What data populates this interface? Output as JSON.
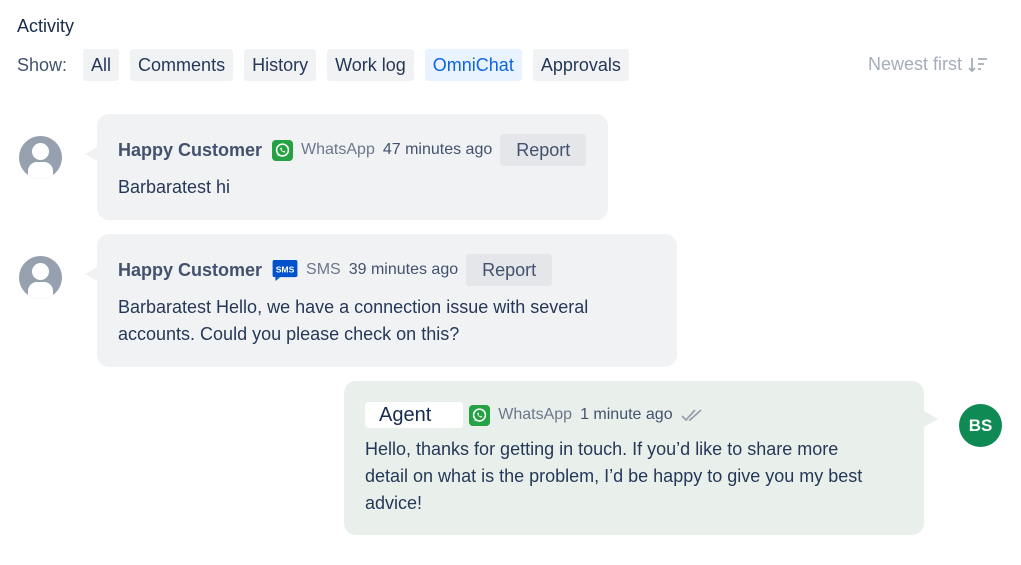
{
  "header": {
    "title": "Activity"
  },
  "filters": {
    "show_label": "Show:",
    "items": [
      "All",
      "Comments",
      "History",
      "Work log",
      "OmniChat",
      "Approvals"
    ],
    "active": "OmniChat"
  },
  "sort": {
    "label": "Newest first",
    "icon": "sort-descending-icon"
  },
  "messages": [
    {
      "sender": "Happy Customer",
      "channel": "WhatsApp",
      "channel_icon": "whatsapp-icon",
      "time": "47 minutes ago",
      "report_label": "Report",
      "text": "Barbaratest hi"
    },
    {
      "sender": "Happy Customer",
      "channel": "SMS",
      "channel_icon": "sms-icon",
      "channel_badge": "SMS",
      "time": "39 minutes ago",
      "report_label": "Report",
      "text_lines": [
        "Barbaratest Hello, we have a connection issue with several",
        "accounts. Could you please check on this?"
      ]
    },
    {
      "sender": "Agent",
      "channel": "WhatsApp",
      "channel_icon": "whatsapp-icon",
      "time": "1 minute ago",
      "status_icon": "double-check-icon",
      "avatar_initials": "BS",
      "text_lines": [
        "Hello, thanks for getting in touch. If you’d like to share more",
        "detail on what is the problem, I’d be happy to give you my best",
        "advice!"
      ]
    }
  ],
  "colors": {
    "whatsapp": "#25a244",
    "sms": "#0052cc",
    "agent_avatar": "#108a55",
    "active_filter": "#0c66e4"
  }
}
